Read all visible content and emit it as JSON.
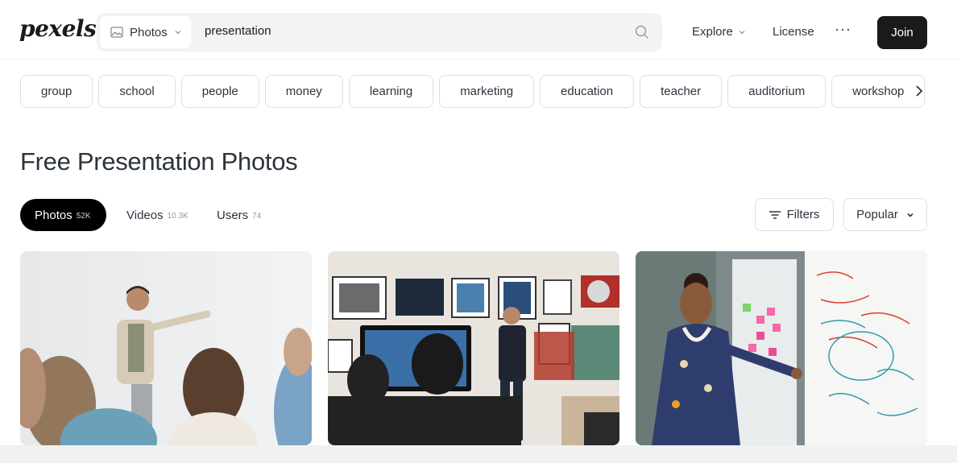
{
  "header": {
    "logo": "pexels",
    "search": {
      "type_label": "Photos",
      "query": "presentation"
    },
    "nav": {
      "explore": "Explore",
      "license": "License",
      "more": "···",
      "join": "Join"
    }
  },
  "chips": [
    "group",
    "school",
    "people",
    "money",
    "learning",
    "marketing",
    "education",
    "teacher",
    "auditorium",
    "workshop"
  ],
  "page_title": "Free Presentation Photos",
  "tabs": [
    {
      "label": "Photos",
      "count": "52K",
      "active": true
    },
    {
      "label": "Videos",
      "count": "10.3K",
      "active": false
    },
    {
      "label": "Users",
      "count": "74",
      "active": false
    }
  ],
  "filters_label": "Filters",
  "sort_label": "Popular",
  "icons": {
    "search": "search-icon",
    "image": "image-icon",
    "chevron": "chevron-down-icon",
    "next": "chevron-right-icon",
    "filters": "filter-lines-icon"
  }
}
